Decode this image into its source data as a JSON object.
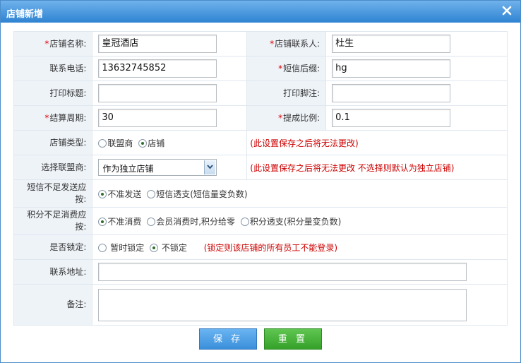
{
  "dialog": {
    "title": "店铺新增"
  },
  "fields": {
    "shop_name": {
      "label": "店铺名称:",
      "value": "皇冠酒店"
    },
    "contact": {
      "label": "店铺联系人:",
      "value": "杜生"
    },
    "phone": {
      "label": "联系电话:",
      "value": "13632745852"
    },
    "sms_suffix": {
      "label": "短信后缀:",
      "value": "hg"
    },
    "print_title": {
      "label": "打印标题:",
      "value": ""
    },
    "print_footer": {
      "label": "打印脚注:",
      "value": ""
    },
    "settle_cycle": {
      "label": "结算周期:",
      "value": "30"
    },
    "commission": {
      "label": "提成比例:",
      "value": "0.1"
    },
    "shop_type": {
      "label": "店铺类型:",
      "options": [
        "联盟商",
        "店铺"
      ],
      "selected": 1,
      "note": "(此设置保存之后将无法更改)"
    },
    "alliance": {
      "label": "选择联盟商:",
      "selected": "作为独立店铺",
      "note": "(此设置保存之后将无法更改 不选择则默认为独立店铺)"
    },
    "sms_insufficient": {
      "label_line1": "短信不足发送应",
      "label_line2": "按:",
      "options": [
        "不准发送",
        "短信透支(短信量变负数)"
      ],
      "selected": 0
    },
    "points_insufficient": {
      "label_line1": "积分不足消费应",
      "label_line2": "按:",
      "options": [
        "不准消费",
        "会员消费时,积分给零",
        "积分透支(积分量变负数)"
      ],
      "selected": 0
    },
    "locked": {
      "label": "是否锁定:",
      "options": [
        "暂时锁定",
        "不锁定"
      ],
      "selected": 1,
      "note": "(锁定则该店铺的所有员工不能登录)"
    },
    "address": {
      "label": "联系地址:",
      "value": ""
    },
    "remark": {
      "label": "备注:",
      "value": ""
    }
  },
  "buttons": {
    "save": "保 存",
    "reset": "重 置"
  },
  "colors": {
    "title_bar": "#2f83d2",
    "save_button": "#3a8fda",
    "reset_button": "#35a129",
    "note_text": "#c00000"
  }
}
